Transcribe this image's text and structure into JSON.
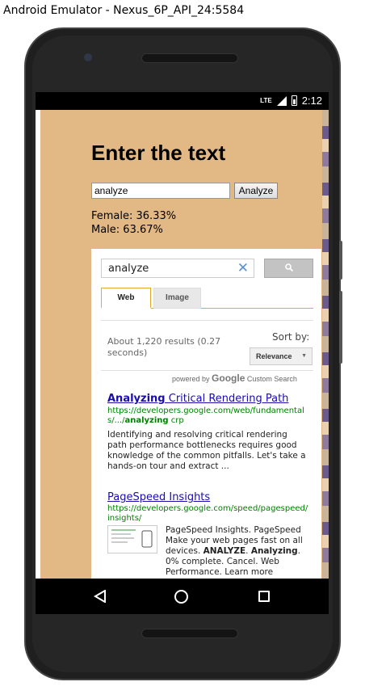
{
  "window": {
    "title": "Android Emulator - Nexus_6P_API_24:5584"
  },
  "status_bar": {
    "network": "LTE",
    "time": "2:12"
  },
  "app": {
    "heading": "Enter the text",
    "input_value": "analyze",
    "analyze_button": "Analyze",
    "female_result": "Female: 36.33%",
    "male_result": "Male: 63.67%"
  },
  "search": {
    "query": "analyze",
    "tabs": [
      {
        "label": "Web",
        "active": true
      },
      {
        "label": "Image",
        "active": false
      }
    ],
    "results_count": "About 1,220 results (0.27 seconds)",
    "sort_by_label": "Sort by:",
    "sort_value": "Relevance",
    "powered_by_prefix": "powered by",
    "powered_by_brand": "Google",
    "powered_by_suffix": "Custom Search",
    "results": [
      {
        "title_bold": "Analyzing",
        "title_rest": " Critical Rendering Path",
        "url_prefix": "https://developers.google.com/web/fundamentals/.../",
        "url_bold": "analyzing",
        "url_suffix": " crp",
        "snippet": "Identifying and resolving critical rendering path performance bottlenecks requires good knowledge of the common pitfalls. Let's take a hands-on tour and extract ..."
      },
      {
        "title": "PageSpeed Insights",
        "url": "https://developers.google.com/speed/pagespeed/insights/",
        "snippet_start": "PageSpeed Insights. PageSpeed Make your web pages fast on all devices. ",
        "snippet_bold1": "ANALYZE",
        "snippet_mid": ". ",
        "snippet_bold2": "Analyzing",
        "snippet_end": ". 0% complete. Cancel. Web Performance. Learn more"
      }
    ]
  },
  "colors": {
    "app_background": "#e2b885",
    "link": "#1a0dab",
    "url": "#008000",
    "tab_accent": "#e6a72e"
  }
}
